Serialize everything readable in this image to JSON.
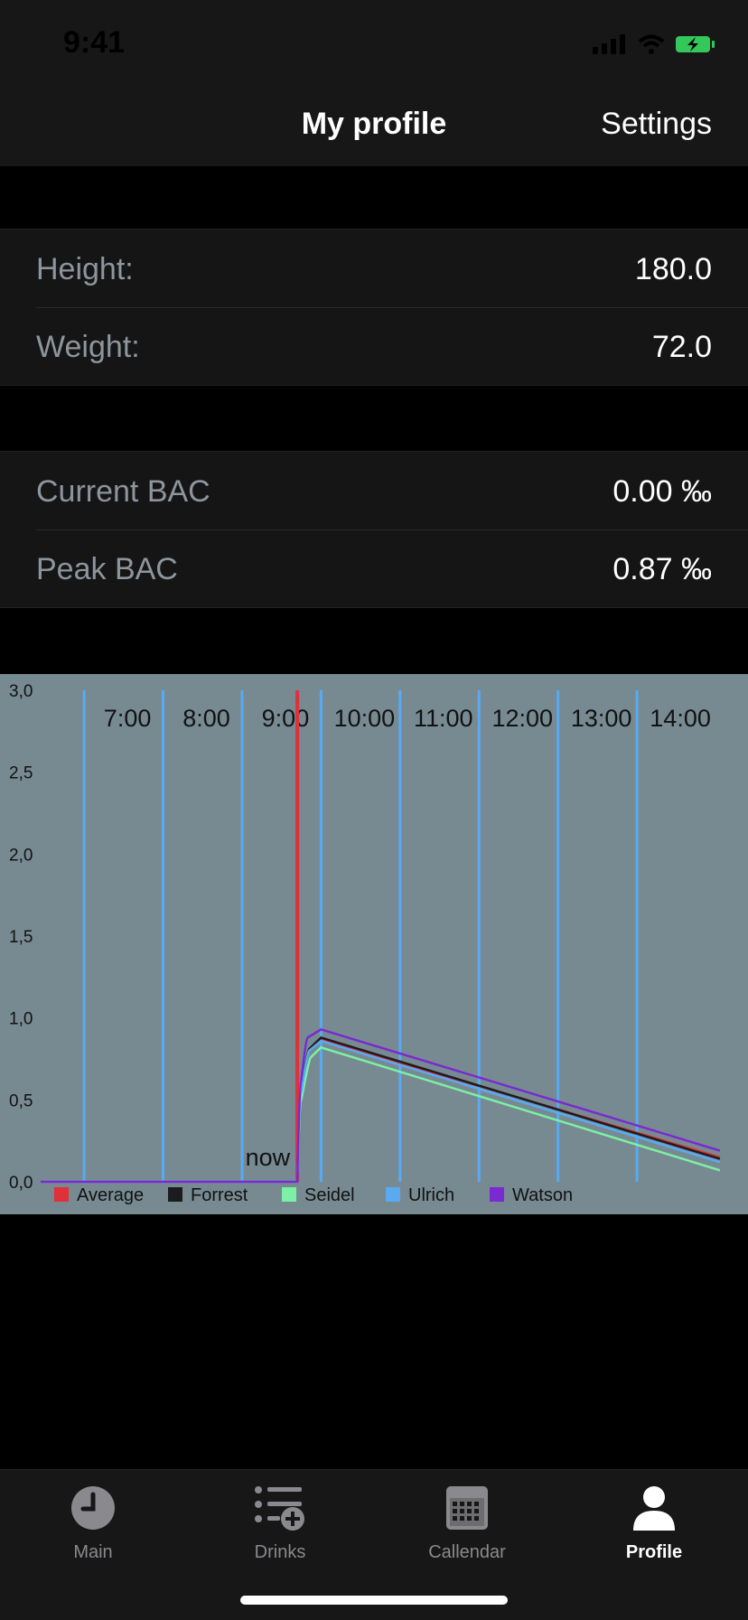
{
  "status": {
    "time": "9:41"
  },
  "nav": {
    "title": "My profile",
    "settings": "Settings"
  },
  "profile": {
    "height_label": "Height:",
    "height_value": "180.0",
    "weight_label": "Weight:",
    "weight_value": "72.0"
  },
  "bac": {
    "current_label": "Current BAC",
    "current_value": "0.00 ‰",
    "peak_label": "Peak BAC",
    "peak_value": "0.87 ‰"
  },
  "chart_data": {
    "type": "line",
    "x_ticks": [
      "7:00",
      "8:00",
      "9:00",
      "10:00",
      "11:00",
      "12:00",
      "13:00",
      "14:00"
    ],
    "y_ticks": [
      "0,0",
      "0,5",
      "1,0",
      "1,5",
      "2,0",
      "2,5",
      "3,0"
    ],
    "ylim": [
      0,
      3
    ],
    "xlim": [
      6.45,
      15.2
    ],
    "now_label": "now",
    "now_x": 9.7,
    "grid": true,
    "legend_position": "bottom-left",
    "series": [
      {
        "name": "Average",
        "color": "#e0303a",
        "x": [
          6.45,
          9.7,
          9.75,
          9.85,
          10.0,
          15.05
        ],
        "y": [
          0,
          0,
          0.55,
          0.8,
          0.87,
          0.15
        ]
      },
      {
        "name": "Forrest",
        "color": "#1c1c1e",
        "x": [
          6.45,
          9.7,
          9.75,
          9.85,
          10.0,
          15.05
        ],
        "y": [
          0,
          0,
          0.56,
          0.81,
          0.88,
          0.14
        ]
      },
      {
        "name": "Seidel",
        "color": "#7cf0a4",
        "x": [
          6.45,
          9.7,
          9.75,
          9.87,
          10.0,
          15.05
        ],
        "y": [
          0,
          0,
          0.5,
          0.76,
          0.82,
          0.07
        ]
      },
      {
        "name": "Ulrich",
        "color": "#5aaaf2",
        "x": [
          6.45,
          9.7,
          9.75,
          9.85,
          10.0,
          15.05
        ],
        "y": [
          0,
          0,
          0.55,
          0.8,
          0.86,
          0.12
        ]
      },
      {
        "name": "Watson",
        "color": "#7a2ad0",
        "x": [
          6.45,
          9.7,
          9.75,
          9.83,
          10.0,
          15.05
        ],
        "y": [
          0,
          0,
          0.62,
          0.88,
          0.93,
          0.19
        ]
      }
    ]
  },
  "tabs": [
    {
      "label": "Main",
      "icon": "clock-icon",
      "active": false
    },
    {
      "label": "Drinks",
      "icon": "add-list-icon",
      "active": false
    },
    {
      "label": "Callendar",
      "icon": "calendar-icon",
      "active": false
    },
    {
      "label": "Profile",
      "icon": "person-icon",
      "active": true
    }
  ]
}
